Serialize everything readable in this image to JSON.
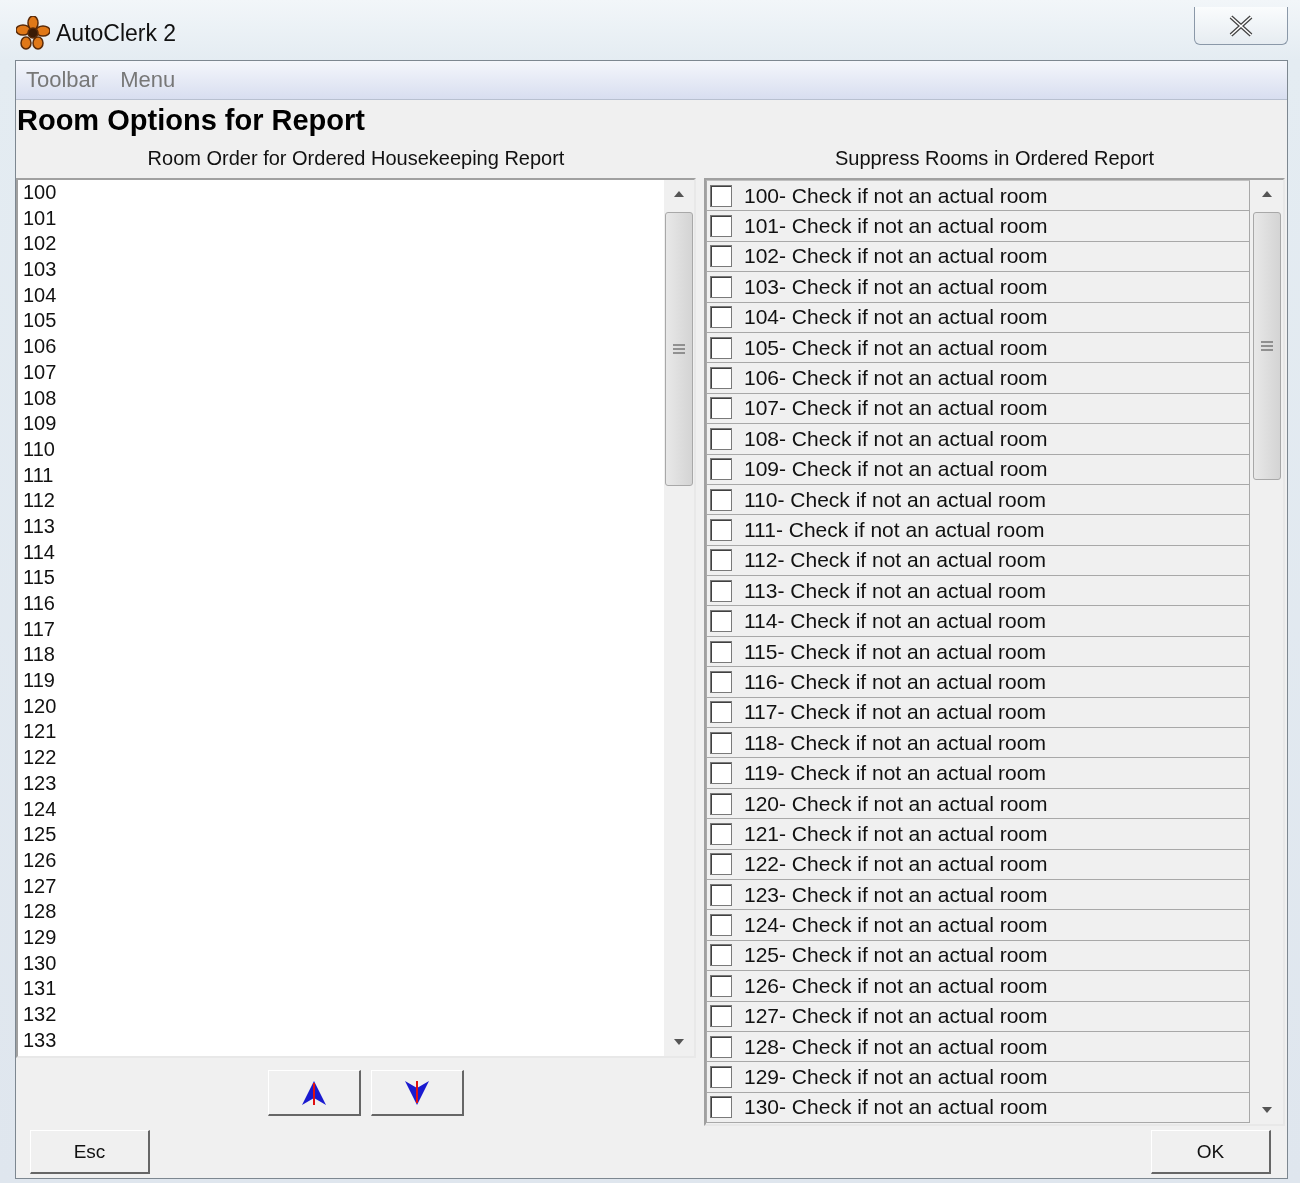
{
  "window": {
    "title": "AutoClerk 2"
  },
  "menu": [
    "Toolbar",
    "Menu"
  ],
  "heading": "Room Options for Report",
  "room_order": {
    "header": "Room Order for Ordered Housekeeping Report",
    "rooms": [
      "100",
      "101",
      "102",
      "103",
      "104",
      "105",
      "106",
      "107",
      "108",
      "109",
      "110",
      "111",
      "112",
      "113",
      "114",
      "115",
      "116",
      "117",
      "118",
      "119",
      "120",
      "121",
      "122",
      "123",
      "124",
      "125",
      "126",
      "127",
      "128",
      "129",
      "130",
      "131",
      "132",
      "133"
    ]
  },
  "suppress": {
    "header": "Suppress Rooms in Ordered Report",
    "rows": [
      {
        "label": "100- Check if not an actual room",
        "checked": false
      },
      {
        "label": "101- Check if not an actual room",
        "checked": false
      },
      {
        "label": "102- Check if not an actual room",
        "checked": false
      },
      {
        "label": "103- Check if not an actual room",
        "checked": false
      },
      {
        "label": "104- Check if not an actual room",
        "checked": false
      },
      {
        "label": "105- Check if not an actual room",
        "checked": false
      },
      {
        "label": "106- Check if not an actual room",
        "checked": false
      },
      {
        "label": "107- Check if not an actual room",
        "checked": false
      },
      {
        "label": "108- Check if not an actual room",
        "checked": false
      },
      {
        "label": "109- Check if not an actual room",
        "checked": false
      },
      {
        "label": "110- Check if not an actual room",
        "checked": false
      },
      {
        "label": "111- Check if not an actual room",
        "checked": false
      },
      {
        "label": "112- Check if not an actual room",
        "checked": false
      },
      {
        "label": "113- Check if not an actual room",
        "checked": false
      },
      {
        "label": "114- Check if not an actual room",
        "checked": false
      },
      {
        "label": "115- Check if not an actual room",
        "checked": false
      },
      {
        "label": "116- Check if not an actual room",
        "checked": false
      },
      {
        "label": "117- Check if not an actual room",
        "checked": false
      },
      {
        "label": "118- Check if not an actual room",
        "checked": false
      },
      {
        "label": "119- Check if not an actual room",
        "checked": false
      },
      {
        "label": "120- Check if not an actual room",
        "checked": false
      },
      {
        "label": "121- Check if not an actual room",
        "checked": false
      },
      {
        "label": "122- Check if not an actual room",
        "checked": false
      },
      {
        "label": "123- Check if not an actual room",
        "checked": false
      },
      {
        "label": "124- Check if not an actual room",
        "checked": false
      },
      {
        "label": "125- Check if not an actual room",
        "checked": false
      },
      {
        "label": "126- Check if not an actual room",
        "checked": false
      },
      {
        "label": "127- Check if not an actual room",
        "checked": false
      },
      {
        "label": "128- Check if not an actual room",
        "checked": false
      },
      {
        "label": "129- Check if not an actual room",
        "checked": false
      },
      {
        "label": "130- Check if not an actual room",
        "checked": false
      }
    ]
  },
  "buttons": {
    "cancel": "Esc",
    "ok": "OK"
  }
}
